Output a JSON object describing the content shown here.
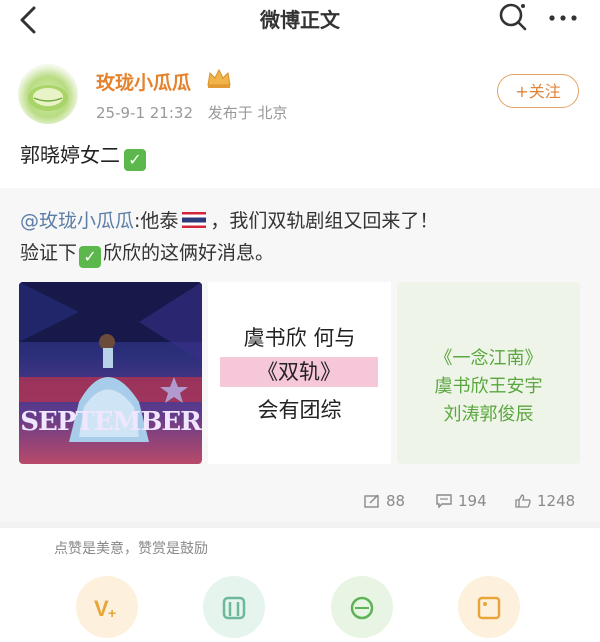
{
  "header": {
    "title": "微博正文"
  },
  "post": {
    "username": "玫珑小瓜瓜",
    "time": "25-9-1 21:32",
    "location": "发布于 北京",
    "follow_label": "+关注",
    "text": "郭晓婷女二"
  },
  "repost": {
    "mention": "@玫珑小瓜瓜",
    "line1_a": ":他泰",
    "line1_b": "，我们双轨剧组又回来了！",
    "line2_a": "验证下",
    "line2_b": "欣欣的这俩好消息。",
    "images": {
      "img1_text": "SEPTEMBER",
      "img2": {
        "line1": "虞书欣 何与",
        "line2": "《双轨》",
        "line3": "会有团综"
      },
      "img3": {
        "line1": "《一念江南》",
        "line2": "虞书欣王安宇",
        "line3": "刘涛郭俊辰"
      }
    },
    "stats": {
      "reposts": "88",
      "comments": "194",
      "likes": "1248"
    }
  },
  "reward": {
    "hint": "点赞是美意，赞赏是鼓励"
  }
}
